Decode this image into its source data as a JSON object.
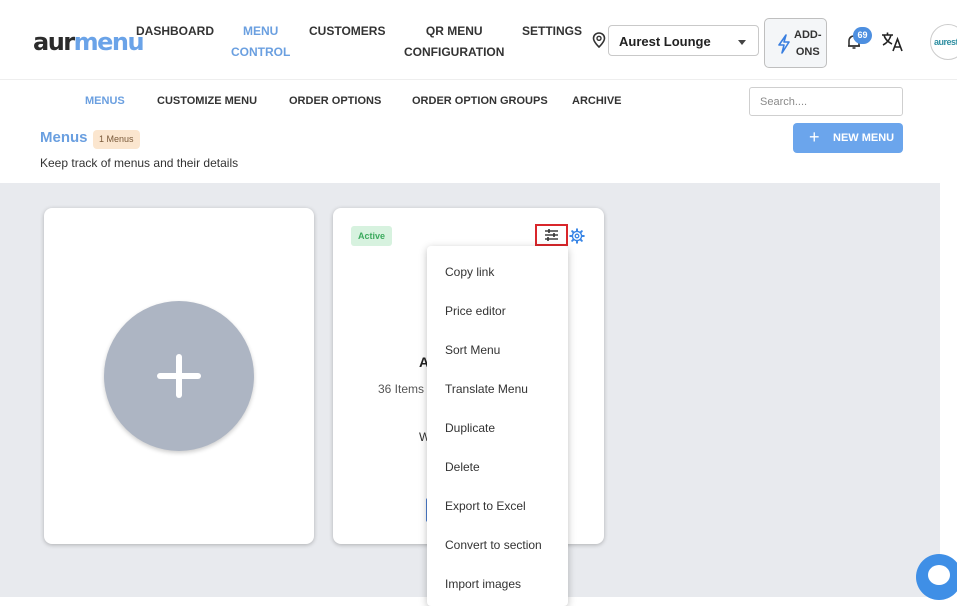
{
  "brand": {
    "part1": "aur",
    "part2": "menu"
  },
  "nav": {
    "dashboard": "DASHBOARD",
    "menu_control_1": "MENU",
    "menu_control_2": "CONTROL",
    "customers": "CUSTOMERS",
    "qr_menu_1": "QR MENU",
    "qr_menu_2": "CONFIGURATION",
    "settings": "SETTINGS"
  },
  "location": {
    "selected": "Aurest Lounge"
  },
  "addons": {
    "line1": "ADD-",
    "line2": "ONS"
  },
  "notifications": {
    "count": "69"
  },
  "avatar": {
    "text": "aurest"
  },
  "subnav": {
    "menus": "MENUS",
    "customize": "CUSTOMIZE MENU",
    "order_options": "ORDER OPTIONS",
    "order_option_groups": "ORDER OPTION GROUPS",
    "archive": "ARCHIVE"
  },
  "search": {
    "placeholder": "Search...."
  },
  "page": {
    "title": "Menus",
    "count_badge": "1 Menus",
    "description": "Keep track of menus and their details",
    "new_menu": "NEW MENU"
  },
  "menu_card": {
    "status": "Active",
    "title_visible": "A",
    "items_visible": "36 Items",
    "line_visible": "W"
  },
  "dropdown": {
    "items": [
      "Copy link",
      "Price editor",
      "Sort Menu",
      "Translate Menu",
      "Duplicate",
      "Delete",
      "Export to Excel",
      "Convert to section",
      "Import images"
    ]
  },
  "colors": {
    "accent": "#6a9fe0",
    "button": "#6ba5ec",
    "content_bg": "#e8eaee",
    "highlight": "#d9262b",
    "status_green": "#3caa5e"
  }
}
